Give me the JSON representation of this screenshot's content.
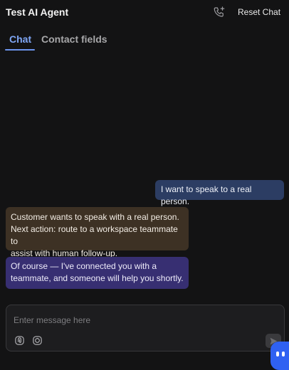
{
  "header": {
    "title": "Test AI Agent",
    "reset_label": "Reset Chat",
    "call_icon": "phone-plus-icon"
  },
  "tabs": [
    {
      "label": "Chat",
      "active": true
    },
    {
      "label": "Contact fields",
      "active": false
    }
  ],
  "messages": [
    {
      "role": "user",
      "text": "I want to speak to a real person."
    },
    {
      "role": "internal-note",
      "lines": [
        "Customer wants to speak with a real person.",
        "Next action: route to a workspace teammate to",
        "assist with human follow-up."
      ]
    },
    {
      "role": "agent",
      "lines": [
        "Of course — I've connected you with a",
        "teammate, and someone will help you shortly."
      ]
    }
  ],
  "composer": {
    "placeholder": "Enter message here",
    "value": "",
    "tools": [
      "attachment-icon",
      "emoji-icon"
    ],
    "send_icon": "send-icon"
  },
  "colors": {
    "background": "#131314",
    "accent": "#6d95ef",
    "user_bubble": "#2c3d63",
    "note_bubble": "#3d3124",
    "agent_bubble": "#372f72",
    "launcher": "#2f61f2"
  }
}
